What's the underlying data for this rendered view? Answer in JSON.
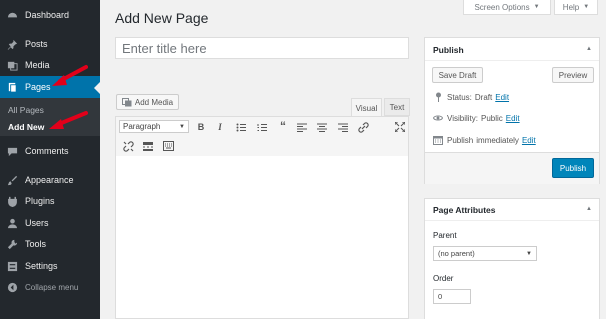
{
  "sidebar": {
    "items": [
      {
        "label": "Dashboard",
        "icon": "dashboard-icon"
      },
      {
        "label": "Posts",
        "icon": "pushpin-icon"
      },
      {
        "label": "Media",
        "icon": "media-icon"
      },
      {
        "label": "Pages",
        "icon": "page-icon"
      },
      {
        "label": "Comments",
        "icon": "comment-icon"
      },
      {
        "label": "Appearance",
        "icon": "paintbrush-icon"
      },
      {
        "label": "Plugins",
        "icon": "plugin-icon"
      },
      {
        "label": "Users",
        "icon": "users-icon"
      },
      {
        "label": "Tools",
        "icon": "wrench-icon"
      },
      {
        "label": "Settings",
        "icon": "settings-icon"
      },
      {
        "label": "Collapse menu",
        "icon": "collapse-icon"
      }
    ],
    "submenu": [
      {
        "label": "All Pages"
      },
      {
        "label": "Add New"
      }
    ]
  },
  "header": {
    "title": "Add New Page",
    "screen_options": "Screen Options",
    "help": "Help"
  },
  "editor": {
    "title_placeholder": "Enter title here",
    "add_media": "Add Media",
    "tab_visual": "Visual",
    "tab_text": "Text",
    "format_select": "Paragraph"
  },
  "publish": {
    "title": "Publish",
    "save_draft": "Save Draft",
    "preview": "Preview",
    "status_label": "Status:",
    "status_value": "Draft",
    "visibility_label": "Visibility:",
    "visibility_value": "Public",
    "schedule_label": "Publish",
    "schedule_value": "immediately",
    "edit": "Edit",
    "publish_button": "Publish"
  },
  "page_attributes": {
    "title": "Page Attributes",
    "parent_label": "Parent",
    "parent_value": "(no parent)",
    "order_label": "Order",
    "order_value": "0"
  },
  "colors": {
    "sidebar_bg": "#23282d",
    "accent": "#0073aa",
    "annotation_arrow": "#e2001a"
  }
}
